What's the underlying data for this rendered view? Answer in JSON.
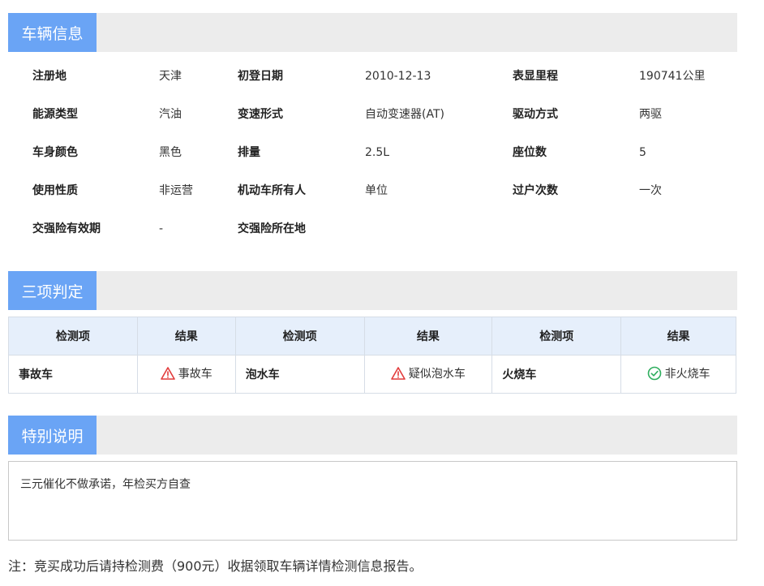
{
  "vehicle_info": {
    "title": "车辆信息",
    "rows": [
      [
        {
          "label": "注册地",
          "value": "天津"
        },
        {
          "label": "初登日期",
          "value": "2010-12-13"
        },
        {
          "label": "表显里程",
          "value": "190741公里"
        }
      ],
      [
        {
          "label": "能源类型",
          "value": "汽油"
        },
        {
          "label": "变速形式",
          "value": "自动变速器(AT)"
        },
        {
          "label": "驱动方式",
          "value": "两驱"
        }
      ],
      [
        {
          "label": "车身颜色",
          "value": "黑色"
        },
        {
          "label": "排量",
          "value": "2.5L"
        },
        {
          "label": "座位数",
          "value": "5"
        }
      ],
      [
        {
          "label": "使用性质",
          "value": "非运营"
        },
        {
          "label": "机动车所有人",
          "value": "单位"
        },
        {
          "label": "过户次数",
          "value": "一次"
        }
      ],
      [
        {
          "label": "交强险有效期",
          "value": "-"
        },
        {
          "label": "交强险所在地",
          "value": ""
        }
      ]
    ]
  },
  "judgement": {
    "title": "三项判定",
    "headers": [
      "检测项",
      "结果",
      "检测项",
      "结果",
      "检测项",
      "结果"
    ],
    "items": [
      {
        "item": "事故车",
        "result": "事故车",
        "status": "warning"
      },
      {
        "item": "泡水车",
        "result": "疑似泡水车",
        "status": "warning"
      },
      {
        "item": "火烧车",
        "result": "非火烧车",
        "status": "ok"
      }
    ]
  },
  "special": {
    "title": "特别说明",
    "text": "三元催化不做承诺，年检买方自查"
  },
  "footer_note": "注：竞买成功后请持检测费（900元）收据领取车辆详情检测信息报告。",
  "colors": {
    "tab_blue": "#6aa4f5",
    "warning_red": "#e23b3b",
    "ok_green": "#2eae5e"
  }
}
